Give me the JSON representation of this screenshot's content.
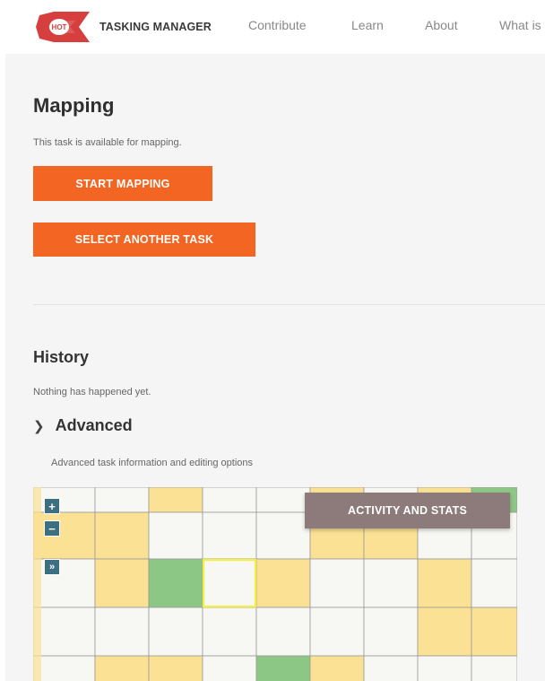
{
  "header": {
    "logo_text": "HOT",
    "brand": "TASKING MANAGER",
    "nav": [
      "Contribute",
      "Learn",
      "About",
      "What is"
    ]
  },
  "mapping": {
    "title": "Mapping",
    "subtitle": "This task is available for mapping.",
    "start_button": "START MAPPING",
    "select_button": "SELECT ANOTHER TASK"
  },
  "history": {
    "title": "History",
    "text": "Nothing has happened yet."
  },
  "advanced": {
    "title": "Advanced",
    "text": "Advanced task information and editing options"
  },
  "map": {
    "zoom_in": "+",
    "zoom_out": "−",
    "expand": "»",
    "activity_button": "ACTIVITY AND STATS"
  },
  "colors": {
    "accent": "#f26522",
    "brand_red": "#d73f3f",
    "map_control": "#3d6f83",
    "activity": "#8d7b7b",
    "tile_yellow": "#fbe194",
    "tile_green": "#8cc785",
    "tile_white": "#f7f7f3",
    "tile_selected": "#f3ef46"
  }
}
